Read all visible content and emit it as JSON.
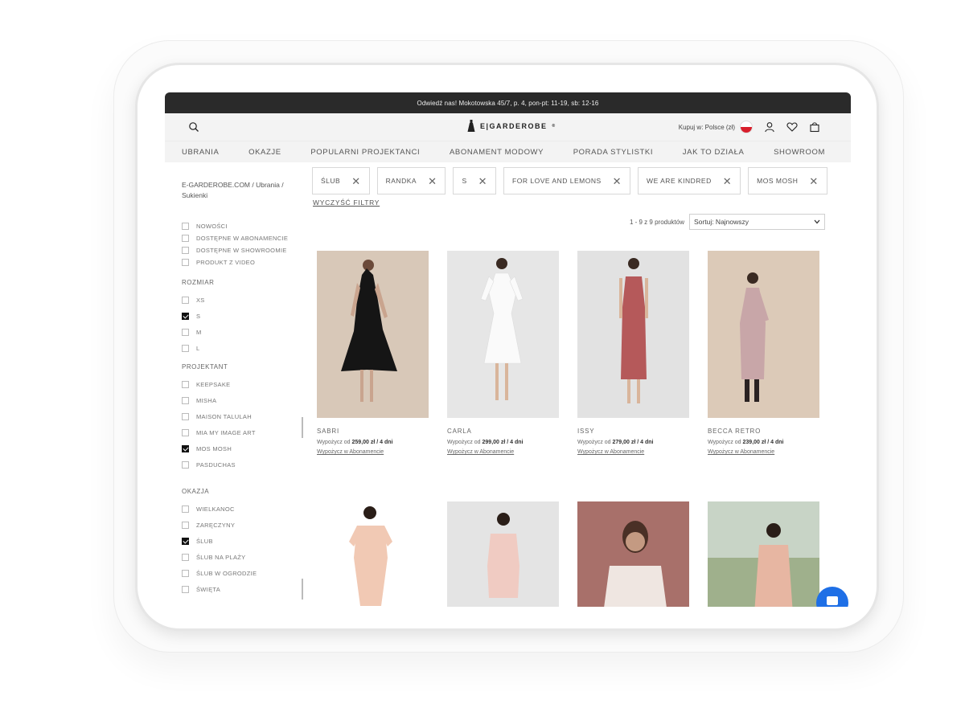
{
  "topbar": {
    "text": "Odwiedź nas! Mokotowska 45/7, p. 4, pon-pt: 11-19, sb: 12-16"
  },
  "header": {
    "logo": "E|GARDEROBE",
    "logo_reg": "®",
    "lang": "Kupuj w: Polsce (zł)"
  },
  "nav": [
    "UBRANIA",
    "OKAZJE",
    "POPULARNI PROJEKTANCI",
    "ABONAMENT MODOWY",
    "PORADA STYLISTKI",
    "JAK TO DZIAŁA",
    "SHOWROOM"
  ],
  "breadcrumb": "E-GARDEROBE.COM / Ubrania / Sukienki",
  "filters_general": [
    "NOWOŚCI",
    "DOSTĘPNE W ABONAMENCIE",
    "DOSTĘPNE W SHOWROOMIE",
    "PRODUKT Z VIDEO"
  ],
  "size": {
    "title": "ROZMIAR",
    "options": [
      {
        "label": "XS",
        "checked": false
      },
      {
        "label": "S",
        "checked": true
      },
      {
        "label": "M",
        "checked": false
      },
      {
        "label": "L",
        "checked": false
      }
    ]
  },
  "designer": {
    "title": "PROJEKTANT",
    "options": [
      {
        "label": "KEEPSAKE",
        "checked": false
      },
      {
        "label": "MISHA",
        "checked": false
      },
      {
        "label": "MAISON TALULAH",
        "checked": false
      },
      {
        "label": "MIA MY IMAGE ART",
        "checked": false
      },
      {
        "label": "MOS MOSH",
        "checked": true
      },
      {
        "label": "PASDUCHAS",
        "checked": false
      }
    ]
  },
  "occasion": {
    "title": "OKAZJA",
    "options": [
      {
        "label": "WIELKANOC",
        "checked": false
      },
      {
        "label": "ZARĘCZYNY",
        "checked": false
      },
      {
        "label": "ŚLUB",
        "checked": true
      },
      {
        "label": "ŚLUB NA PLAŻY",
        "checked": false
      },
      {
        "label": "ŚLUB W OGRODZIE",
        "checked": false
      },
      {
        "label": "ŚWIĘTA",
        "checked": false
      }
    ]
  },
  "chips": [
    "ŚLUB",
    "RANDKA",
    "S",
    "FOR LOVE AND LEMONS",
    "WE ARE KINDRED",
    "MOS MOSH"
  ],
  "clear_filters": "WYCZYŚĆ FILTRY",
  "results": {
    "count": "1 - 9 z 9 produktów",
    "sort": "Sortuj: Najnowszy"
  },
  "products": [
    {
      "name": "SABRI",
      "price_prefix": "Wypożycz od",
      "price": "259,00 zł / 4 dni",
      "sub": "Wypożycz w Abonamencie"
    },
    {
      "name": "CARLA",
      "price_prefix": "Wypożycz od",
      "price": "299,00 zł / 4 dni",
      "sub": "Wypożycz w Abonamencie"
    },
    {
      "name": "ISSY",
      "price_prefix": "Wypożycz od",
      "price": "279,00 zł / 4 dni",
      "sub": "Wypożycz w Abonamencie"
    },
    {
      "name": "BECCA RETRO",
      "price_prefix": "Wypożycz od",
      "price": "239,00 zł / 4 dni",
      "sub": "Wypożycz w Abonamencie"
    }
  ],
  "colors": {
    "topbar": "#2a2a2a",
    "header": "#f3f3f3",
    "chat": "#1e6fe6"
  }
}
